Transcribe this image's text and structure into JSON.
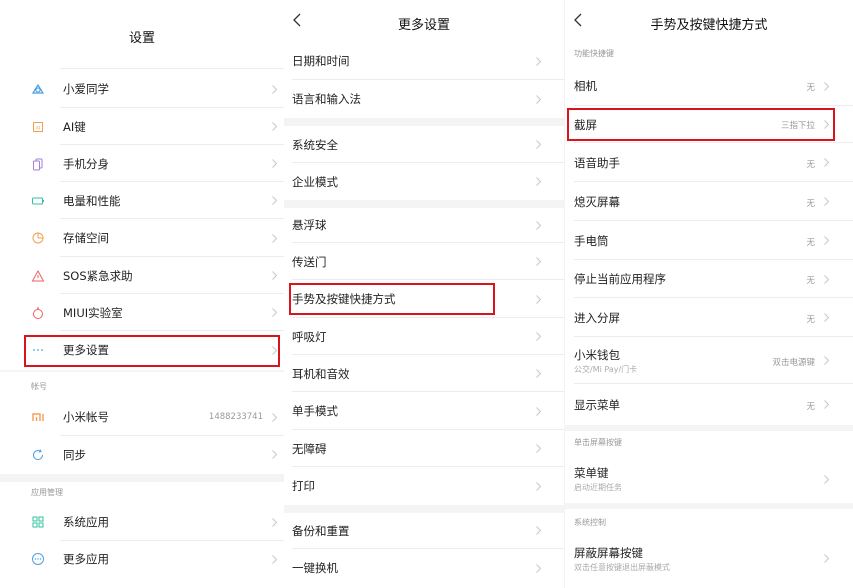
{
  "settings": {
    "title": "设置",
    "items": [
      {
        "label": "小爱同学",
        "icon": "xiaoai-icon"
      },
      {
        "label": "AI键",
        "icon": "ai-key-icon"
      },
      {
        "label": "手机分身",
        "icon": "phone-clone-icon"
      },
      {
        "label": "电量和性能",
        "icon": "battery-icon"
      },
      {
        "label": "存储空间",
        "icon": "storage-icon"
      },
      {
        "label": "SOS紧急求助",
        "icon": "sos-icon"
      },
      {
        "label": "MIUI实验室",
        "icon": "lab-icon"
      },
      {
        "label": "更多设置",
        "icon": "more-icon"
      }
    ],
    "account_section": "帐号",
    "account": {
      "label": "小米帐号",
      "value": "1488233741",
      "icon": "mi-logo-icon"
    },
    "sync": {
      "label": "同步",
      "icon": "sync-icon"
    },
    "apps_section": "应用管理",
    "system_apps": {
      "label": "系统应用",
      "icon": "grid-apps-icon"
    },
    "more_apps": {
      "label": "更多应用",
      "icon": "more-apps-icon"
    }
  },
  "more_settings": {
    "title": "更多设置",
    "items": [
      "日期和时间",
      "语言和输入法",
      "系统安全",
      "企业模式",
      "悬浮球",
      "传送门",
      "手势及按键快捷方式",
      "呼吸灯",
      "耳机和音效",
      "单手模式",
      "无障碍",
      "打印",
      "备份和重置",
      "一键换机"
    ]
  },
  "shortcuts": {
    "title": "手势及按键快捷方式",
    "section_function": "功能快捷键",
    "items": [
      {
        "label": "相机",
        "value": "无"
      },
      {
        "label": "截屏",
        "value": "三指下拉"
      },
      {
        "label": "语音助手",
        "value": "无"
      },
      {
        "label": "熄灭屏幕",
        "value": "无"
      },
      {
        "label": "手电筒",
        "value": "无"
      },
      {
        "label": "停止当前应用程序",
        "value": "无"
      },
      {
        "label": "进入分屏",
        "value": "无"
      },
      {
        "label": "小米钱包",
        "sub": "公交/Mi Pay/门卡",
        "value": "双击电源键"
      },
      {
        "label": "显示菜单",
        "value": "无"
      }
    ],
    "section_single": "单击屏幕按键",
    "menu_key": {
      "label": "菜单键",
      "sub": "启动近期任务"
    },
    "section_system": "系统控制",
    "block_keys": {
      "label": "屏蔽屏幕按键",
      "sub": "双击任意按键退出屏蔽模式"
    }
  },
  "colors": {
    "highlight": "#d8141c",
    "icon_orange": "#f0a050"
  }
}
